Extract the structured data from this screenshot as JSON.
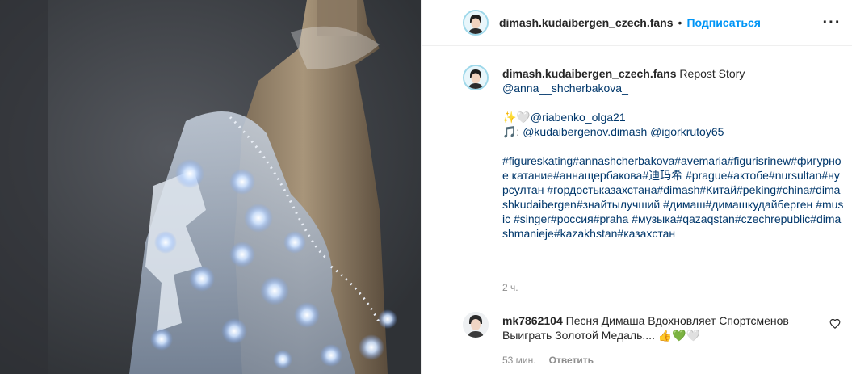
{
  "post": {
    "username": "dimash.kudaibergen_czech.fans",
    "dot": "•",
    "follow_label": "Подписаться",
    "more_label": "···"
  },
  "caption": {
    "username": "dimash.kudaibergen_czech.fans",
    "line1": "Repost Story",
    "line2": "@anna__shcherbakova_",
    "line3_prefix": "✨🤍",
    "line3_mention": "@riabenko_olga21",
    "line4_prefix": "🎵: ",
    "line4_mention1": "@kudaibergenov.dimash",
    "line4_mention2": "@igorkrutoy65",
    "tags": "#figureskating#annashcherbakova#avemaria#figurisrinew#фигурное катание#аннащербакова#迪玛希 #prague#актобе#nursultan#нурсултан #гордостьказахстана#dimash#Китай#peking#china#dimashkudaibergen#знайтылучший #димаш#димашкудайберген #music #singer#россия#praha #музыка#qazaqstan#czechrepublic#dimashmanieje#kazakhstan#казахстан",
    "time_ago": "2 ч."
  },
  "comment": {
    "username": "mk7862104",
    "text": "Песня Димаша Вдохновляет Спортсменов Выиграть Золотой Медаль.... 👍💚🤍",
    "time_ago": "53 мин.",
    "reply_label": "Ответить"
  },
  "icons": {
    "more": "more-horizontal-icon",
    "like": "heart-icon"
  },
  "colors": {
    "link": "#0095f6",
    "mention": "#00376b",
    "secondary_text": "#8e8e8e",
    "text": "#262626"
  }
}
